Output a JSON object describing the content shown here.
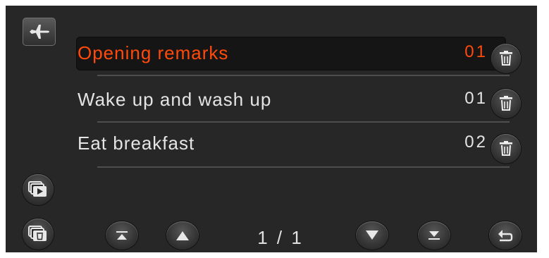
{
  "colors": {
    "screen_bg": "#272727",
    "selected_text": "#ff4a0c",
    "normal_text": "#e4e4e4"
  },
  "header": {
    "mode_icon": "airplane-icon"
  },
  "list": {
    "items": [
      {
        "label": "Opening remarks",
        "count": "01",
        "selected": true
      },
      {
        "label": "Wake up and wash up",
        "count": "01",
        "selected": false
      },
      {
        "label": "Eat breakfast",
        "count": "02",
        "selected": false
      }
    ],
    "delete_icon": "trash-icon"
  },
  "sidebar": {
    "play_icon": "playlist-play-icon",
    "delete_icon": "playlist-delete-icon"
  },
  "pager": {
    "current": "1",
    "separator": " / ",
    "total": "1",
    "text": "1 / 1",
    "first_icon": "page-first-icon",
    "up_icon": "page-up-icon",
    "down_icon": "page-down-icon",
    "last_icon": "page-last-icon",
    "back_icon": "back-return-icon"
  }
}
